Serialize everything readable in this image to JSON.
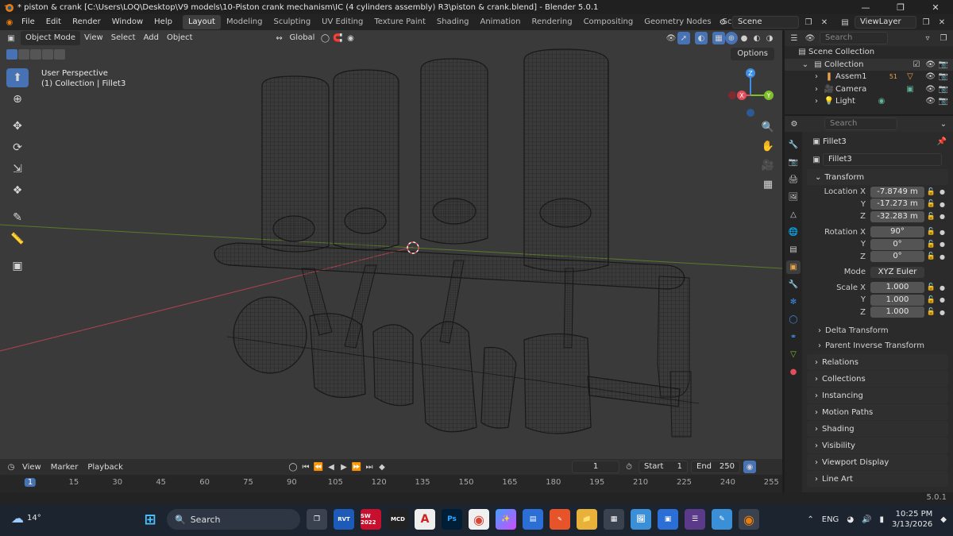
{
  "window": {
    "title": "* piston & crank [C:\\Users\\LOQ\\Desktop\\V9 models\\10-Piston crank mechanism\\IC (4 cylinders assembly) R3\\piston & crank.blend] - Blender 5.0.1"
  },
  "menu": [
    "File",
    "Edit",
    "Render",
    "Window",
    "Help"
  ],
  "workspaces": [
    "Layout",
    "Modeling",
    "Sculpting",
    "UV Editing",
    "Texture Paint",
    "Shading",
    "Animation",
    "Rendering",
    "Compositing",
    "Geometry Nodes",
    "Scripting"
  ],
  "active_workspace": "Layout",
  "scene": {
    "name": "Scene",
    "view_layer": "ViewLayer"
  },
  "viewport": {
    "mode": "Object Mode",
    "menus": [
      "View",
      "Select",
      "Add",
      "Object"
    ],
    "transform_orientation": "Global",
    "options": "Options",
    "overlay_line1": "User Perspective",
    "overlay_line2": "(1) Collection | Fillet3",
    "gizmo": {
      "x": "X",
      "y": "Y",
      "z": "Z"
    }
  },
  "timeline": {
    "menus": [
      "View",
      "Marker",
      "Playback"
    ],
    "current_frame": "1",
    "start_label": "Start",
    "start": "1",
    "end_label": "End",
    "end": "250",
    "ticks": [
      "1",
      "15",
      "30",
      "45",
      "60",
      "75",
      "90",
      "105",
      "120",
      "135",
      "150",
      "165",
      "180",
      "195",
      "210",
      "225",
      "240",
      "255"
    ]
  },
  "outliner": {
    "search_placeholder": "Search",
    "root": "Scene Collection",
    "collection": "Collection",
    "items": [
      "Assem1",
      "Camera",
      "Light"
    ],
    "assem_badge": "51"
  },
  "properties": {
    "search_placeholder": "Search",
    "object_name": "Fillet3",
    "datablock": "Fillet3",
    "transform_header": "Transform",
    "location": {
      "label": "Location X",
      "x": "-7.8749 m",
      "y": "-17.273 m",
      "z": "-32.283 m"
    },
    "rotation": {
      "label": "Rotation X",
      "x": "90°",
      "y": "0°",
      "z": "0°"
    },
    "mode_label": "Mode",
    "mode": "XYZ Euler",
    "scale": {
      "label": "Scale X",
      "x": "1.000",
      "y": "1.000",
      "z": "1.000"
    },
    "axis_y": "Y",
    "axis_z": "Z",
    "subpanels": [
      "Delta Transform",
      "Parent Inverse Transform"
    ],
    "panels": [
      "Relations",
      "Collections",
      "Instancing",
      "Motion Paths",
      "Shading",
      "Visibility",
      "Viewport Display",
      "Line Art"
    ]
  },
  "statusbar": {
    "version": "5.0.1"
  },
  "taskbar": {
    "weather": "14°",
    "search": "Search",
    "lang": "ENG",
    "time": "10:25 PM",
    "date": "3/13/2026",
    "app_labels": [
      "RVT",
      "SW 2022",
      "MCD",
      "A",
      "Ps"
    ]
  },
  "colors": {
    "accent": "#4772b3",
    "viewport_bg": "#3a3a3a",
    "axis_x": "#e44d5a",
    "axis_y": "#7fbf2a",
    "axis_z": "#3d8ee8",
    "taskbar": "#1c2430"
  }
}
